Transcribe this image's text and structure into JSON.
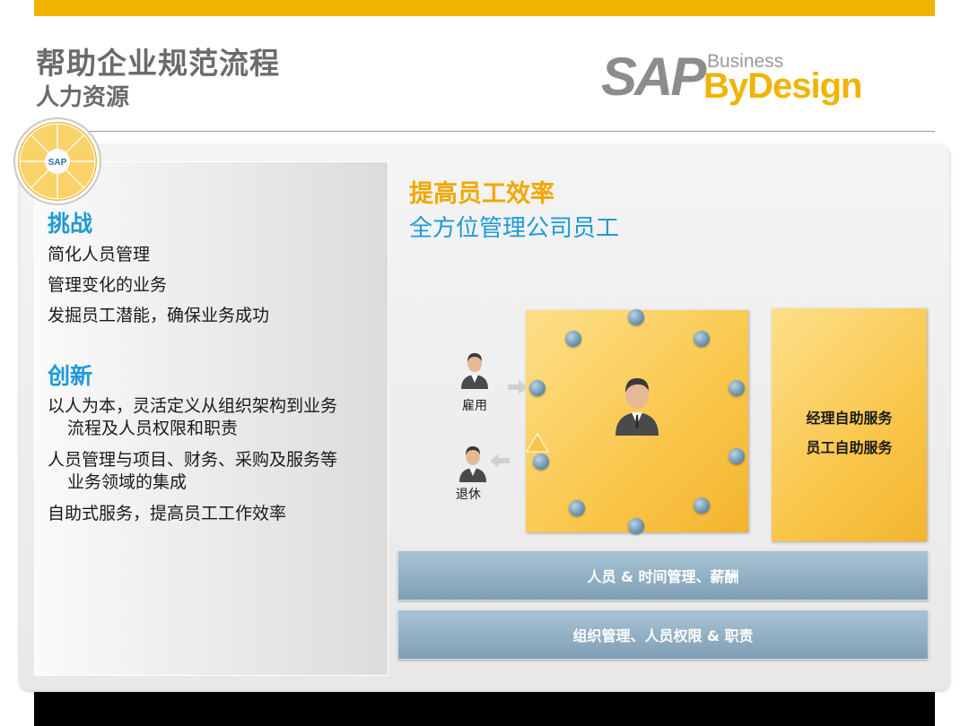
{
  "header": {
    "title": "帮助企业规范流程",
    "subtitle": "人力资源"
  },
  "logo": {
    "sap": "SAP",
    "business": "Business",
    "bydesign": "ByDesign",
    "badge_text": "SAP"
  },
  "left": {
    "challenge_heading": "挑战",
    "challenge_items": [
      "简化人员管理",
      "管理变化的业务",
      "发掘员工潜能，确保业务成功"
    ],
    "innovation_heading": "创新",
    "innovation_items": [
      {
        "line1": "以人为本，灵活定义从组织架构到业务",
        "line2": "流程及人员权限和职责"
      },
      {
        "line1": "人员管理与项目、财务、采购及服务等",
        "line2": "业务领域的集成"
      },
      {
        "line1": "自助式服务，提高员工工作效率",
        "line2": ""
      }
    ]
  },
  "right": {
    "title": "提高员工效率",
    "subtitle": "全方位管理公司员工",
    "hire_label": "雇用",
    "retire_label": "退休",
    "self_service": [
      "经理自助服务",
      "员工自助服务"
    ],
    "band1": "人员 & 时间管理、薪酬",
    "band2": "组织管理、人员权限 & 职责"
  },
  "colors": {
    "accent_yellow": "#f0b400",
    "heading_blue": "#1e9ad6",
    "title_orange": "#f0a800",
    "band_blue": "#7e9fb5"
  }
}
